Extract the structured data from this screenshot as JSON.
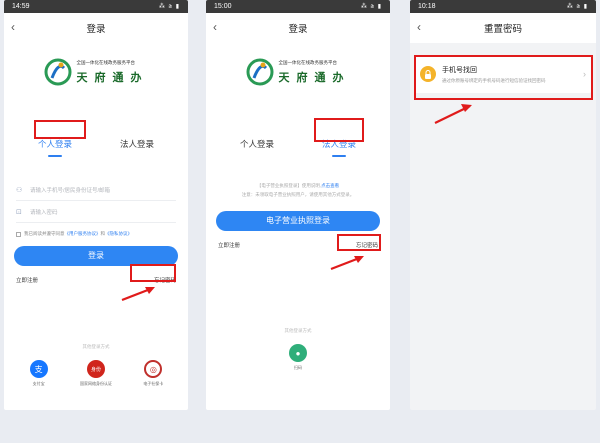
{
  "phone1": {
    "time": "14:59",
    "status_icons": "⁂ ⩭ ▮",
    "title": "登录",
    "logo": {
      "subtitle": "全国一体化在线政务服务平台",
      "name": "天府通办"
    },
    "tabs": [
      "个人登录",
      "法人登录"
    ],
    "fields": [
      {
        "placeholder": "请输入手机号/居民身份证号/邮箱",
        "icon": "user-icon"
      },
      {
        "placeholder": "请输入密码",
        "icon": "lock-icon"
      }
    ],
    "agree": {
      "prefix": "我已阅读并遵守同意",
      "link1": "《用户服务协议》",
      "and": "和",
      "link2": "《隐私协议》"
    },
    "login_button": "登录",
    "register": "立即注册",
    "forgot": "忘记密码",
    "other_title": "其他登录方式",
    "other_methods": [
      {
        "label": "支付宝",
        "color": "#1677ff",
        "glyph": "支"
      },
      {
        "label": "国家网络身份认证",
        "color": "#d0251c",
        "glyph": "身份"
      },
      {
        "label": "电子社保卡",
        "color": "#c0302c",
        "glyph": "◎"
      }
    ]
  },
  "phone2": {
    "time": "15:00",
    "status_icons": "⁂ ⩭ ▮",
    "title": "登录",
    "logo": {
      "subtitle": "全国一体化在线政务服务平台",
      "name": "天府通办"
    },
    "tabs": [
      "个人登录",
      "法人登录"
    ],
    "notice_line1_a": "【电子营业执照登录】使用说明,",
    "notice_line1_link": "点击查看",
    "notice_line2": "注意：未领取电子营业执照用户，请使用其他方式登录。",
    "license_button": "电子营业执照登录",
    "register": "立即注册",
    "forgot": "忘记密码",
    "other_title": "其他登录方式",
    "other_methods": [
      {
        "label": "扫码",
        "color": "#2fae7a",
        "glyph": "●"
      }
    ]
  },
  "phone3": {
    "time": "10:18",
    "status_icons": "⁂ ⩭ ▮",
    "title": "重置密码",
    "card": {
      "title": "手机号找回",
      "desc": "通过你原账号绑定的手机号码进行短信验证找回密码"
    }
  },
  "colors": {
    "accent": "#2e86f3",
    "highlight": "#e01b1b",
    "lock": "#f4b32a"
  }
}
